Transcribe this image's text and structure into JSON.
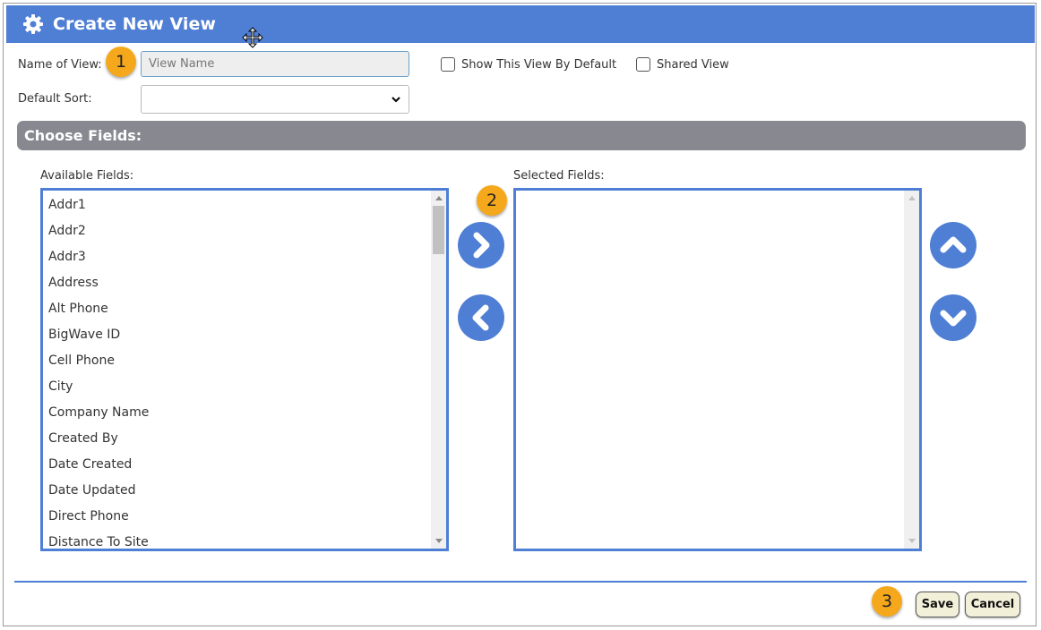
{
  "dialog": {
    "title": "Create New View"
  },
  "form": {
    "name_label": "Name of View:",
    "name_placeholder": "View Name",
    "name_value": "",
    "show_default_label": "Show This View By Default",
    "shared_label": "Shared View",
    "default_sort_label": "Default Sort:",
    "default_sort_value": ""
  },
  "section": {
    "title": "Choose Fields:"
  },
  "available": {
    "label": "Available Fields:",
    "items": [
      "Addr1",
      "Addr2",
      "Addr3",
      "Address",
      "Alt Phone",
      "BigWave ID",
      "Cell Phone",
      "City",
      "Company Name",
      "Created By",
      "Date Created",
      "Date Updated",
      "Direct Phone",
      "Distance To Site"
    ]
  },
  "selected": {
    "label": "Selected Fields:",
    "items": []
  },
  "badges": [
    "1",
    "2",
    "3"
  ],
  "footer": {
    "save_label": "Save",
    "cancel_label": "Cancel"
  },
  "colors": {
    "accent": "#4f7fd4",
    "section": "#878890",
    "badge": "#f5a81c",
    "button_bg": "#f3f0d9"
  }
}
